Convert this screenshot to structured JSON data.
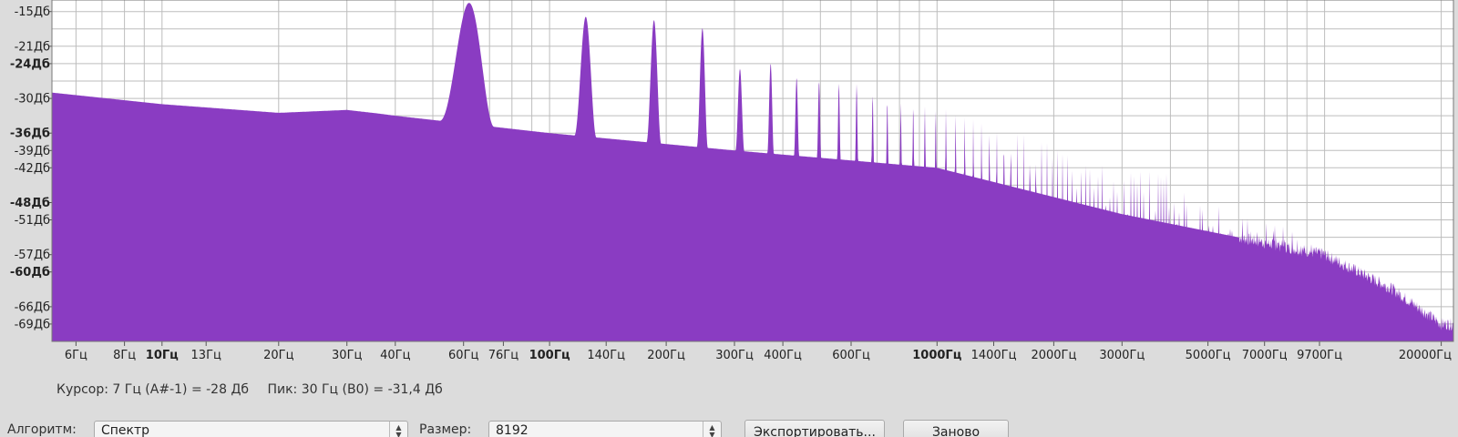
{
  "chart_data": {
    "type": "area",
    "x_scale": "log",
    "xlim": [
      5.2,
      21500
    ],
    "ylim": [
      -72,
      -13
    ],
    "grid": true,
    "fill_color": "#8a3cc2",
    "y_ticks": [
      {
        "value": -15,
        "label": "-15Дб",
        "bold": false
      },
      {
        "value": -21,
        "label": "-21Дб",
        "bold": false
      },
      {
        "value": -24,
        "label": "-24Дб",
        "bold": true
      },
      {
        "value": -30,
        "label": "-30Дб",
        "bold": false
      },
      {
        "value": -36,
        "label": "-36Дб",
        "bold": true
      },
      {
        "value": -39,
        "label": "-39Дб",
        "bold": false
      },
      {
        "value": -42,
        "label": "-42Дб",
        "bold": false
      },
      {
        "value": -48,
        "label": "-48Дб",
        "bold": true
      },
      {
        "value": -51,
        "label": "-51Дб",
        "bold": false
      },
      {
        "value": -57,
        "label": "-57Дб",
        "bold": false
      },
      {
        "value": -60,
        "label": "-60Дб",
        "bold": true
      },
      {
        "value": -66,
        "label": "-66Дб",
        "bold": false
      },
      {
        "value": -69,
        "label": "-69Дб",
        "bold": false
      }
    ],
    "x_ticks": [
      {
        "value": 6,
        "label": "6Гц",
        "bold": false
      },
      {
        "value": 8,
        "label": "8Гц",
        "bold": false
      },
      {
        "value": 10,
        "label": "10Гц",
        "bold": true
      },
      {
        "value": 13,
        "label": "13Гц",
        "bold": false
      },
      {
        "value": 20,
        "label": "20Гц",
        "bold": false
      },
      {
        "value": 30,
        "label": "30Гц",
        "bold": false
      },
      {
        "value": 40,
        "label": "40Гц",
        "bold": false
      },
      {
        "value": 60,
        "label": "60Гц",
        "bold": false
      },
      {
        "value": 76,
        "label": "76Гц",
        "bold": false
      },
      {
        "value": 100,
        "label": "100Гц",
        "bold": true
      },
      {
        "value": 140,
        "label": "140Гц",
        "bold": false
      },
      {
        "value": 200,
        "label": "200Гц",
        "bold": false
      },
      {
        "value": 300,
        "label": "300Гц",
        "bold": false
      },
      {
        "value": 400,
        "label": "400Гц",
        "bold": false
      },
      {
        "value": 600,
        "label": "600Гц",
        "bold": false
      },
      {
        "value": 1000,
        "label": "1000Гц",
        "bold": true
      },
      {
        "value": 1400,
        "label": "1400Гц",
        "bold": false
      },
      {
        "value": 2000,
        "label": "2000Гц",
        "bold": false
      },
      {
        "value": 3000,
        "label": "3000Гц",
        "bold": false
      },
      {
        "value": 5000,
        "label": "5000Гц",
        "bold": false
      },
      {
        "value": 7000,
        "label": "7000Гц",
        "bold": false
      },
      {
        "value": 9700,
        "label": "9700Гц",
        "bold": false
      },
      {
        "value": 20000,
        "label": "20000Гц",
        "bold": false
      }
    ],
    "x_grid": [
      6,
      7,
      8,
      9,
      10,
      20,
      30,
      40,
      50,
      60,
      70,
      80,
      90,
      100,
      200,
      300,
      400,
      500,
      600,
      700,
      800,
      900,
      1000,
      2000,
      3000,
      4000,
      5000,
      6000,
      7000,
      8000,
      9000,
      10000,
      20000
    ],
    "y_grid": [
      -15,
      -18,
      -21,
      -24,
      -27,
      -30,
      -33,
      -36,
      -39,
      -42,
      -45,
      -48,
      -51,
      -54,
      -57,
      -60,
      -63,
      -66,
      -69
    ],
    "spectrum": {
      "baseline": [
        [
          5.2,
          -29
        ],
        [
          10,
          -31
        ],
        [
          20,
          -32.5
        ],
        [
          30,
          -32
        ],
        [
          36,
          -32.6
        ],
        [
          40,
          -33
        ],
        [
          100,
          -36
        ],
        [
          300,
          -39
        ],
        [
          1000,
          -42
        ],
        [
          3000,
          -50
        ],
        [
          10000,
          -57
        ],
        [
          15000,
          -63
        ],
        [
          20000,
          -69
        ],
        [
          21500,
          -69
        ]
      ],
      "fundamental": {
        "freq": 62,
        "peak_db": -13.5
      },
      "harmonic_peaks": [
        [
          62,
          -13.5
        ],
        [
          128,
          -16
        ],
        [
          190,
          -16.5
        ],
        [
          255,
          -18
        ],
        [
          320,
          -26
        ],
        [
          385,
          -23.5
        ],
        [
          445,
          -27
        ],
        [
          508,
          -27
        ],
        [
          572,
          -27.5
        ],
        [
          636,
          -27.5
        ],
        [
          700,
          -30
        ],
        [
          765,
          -30.5
        ],
        [
          830,
          -31
        ],
        [
          895,
          -31
        ],
        [
          960,
          -31.5
        ],
        [
          1025,
          -31.5
        ],
        [
          3000,
          -42
        ],
        [
          4000,
          -43
        ],
        [
          6000,
          -50
        ],
        [
          8000,
          -53
        ],
        [
          9000,
          -56
        ]
      ]
    }
  },
  "status": {
    "cursor": "Курсор: 7 Гц (A#-1) = -28 Дб",
    "peak": "Пик: 30 Гц (B0) = -31,4 Дб"
  },
  "controls": {
    "algorithm_label": "Алгоритм:",
    "algorithm_value": "Спектр",
    "size_label": "Размер:",
    "size_value": "8192",
    "export_label": "Экспортировать...",
    "replot_label": "Заново"
  },
  "icons": {
    "spin": "spin-arrows-icon"
  }
}
